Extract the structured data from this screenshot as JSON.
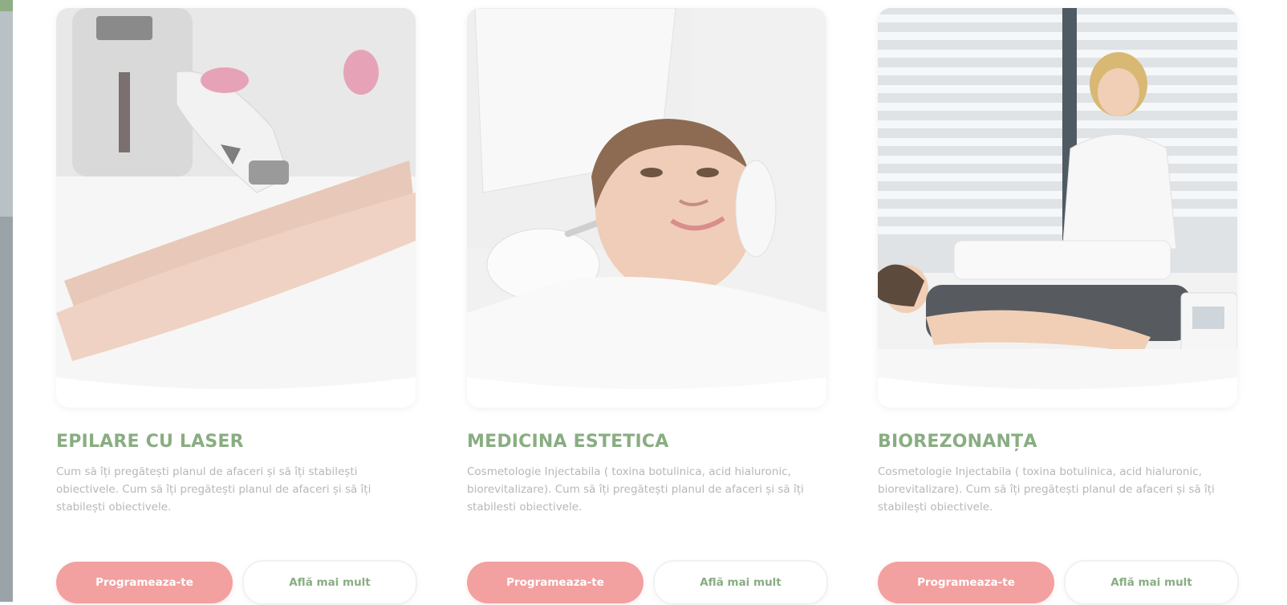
{
  "services": [
    {
      "title": "EPILARE CU LASER",
      "description": "Cum să îți pregătești planul de afaceri și să îți stabilești obiectivele. Cum să îți pregătești planul de afaceri și să îți stabilești obiectivele.",
      "primary_button": "Programeaza-te",
      "secondary_button": "Află mai mult"
    },
    {
      "title": "MEDICINA ESTETICA",
      "description": "Cosmetologie Injectabila ( toxina botulinica, acid hialuronic, biorevitalizare). Cum să îți pregătești planul de afaceri și să îți stabilesti obiectivele.",
      "primary_button": "Programeaza-te",
      "secondary_button": "Află mai mult"
    },
    {
      "title": "BIOREZONANȚA",
      "description": "Cosmetologie Injectabila ( toxina botulinica, acid hialuronic, biorevitalizare). Cum să îți pregătești planul de afaceri și să îți stabilești obiectivele.",
      "primary_button": "Programeaza-te",
      "secondary_button": "Află mai mult"
    }
  ],
  "colors": {
    "title_green": "#89ad82",
    "text_gray": "#b7b7b7",
    "button_pink": "#f3a0a0"
  }
}
